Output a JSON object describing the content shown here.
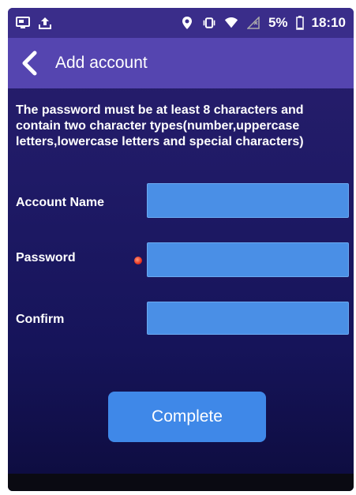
{
  "status_bar": {
    "battery_percent": "5%",
    "time": "18:10"
  },
  "header": {
    "title": "Add account"
  },
  "rules": {
    "text": "The password must be at least 8 characters and contain two character types(number,uppercase letters,lowercase letters and special characters)"
  },
  "form": {
    "account_name_label": "Account Name",
    "password_label": "Password",
    "confirm_label": "Confirm",
    "account_name_value": "",
    "password_value": "",
    "confirm_value": ""
  },
  "actions": {
    "complete_label": "Complete"
  },
  "colors": {
    "header": "#5545b0",
    "input": "#4a8fe6",
    "button": "#3f88e8",
    "required_dot": "#e8321e"
  },
  "icons": [
    "screen-mirror-icon",
    "upload-icon",
    "location-icon",
    "vibrate-icon",
    "wifi-icon",
    "no-signal-icon",
    "battery-icon",
    "back-chevron-icon"
  ]
}
